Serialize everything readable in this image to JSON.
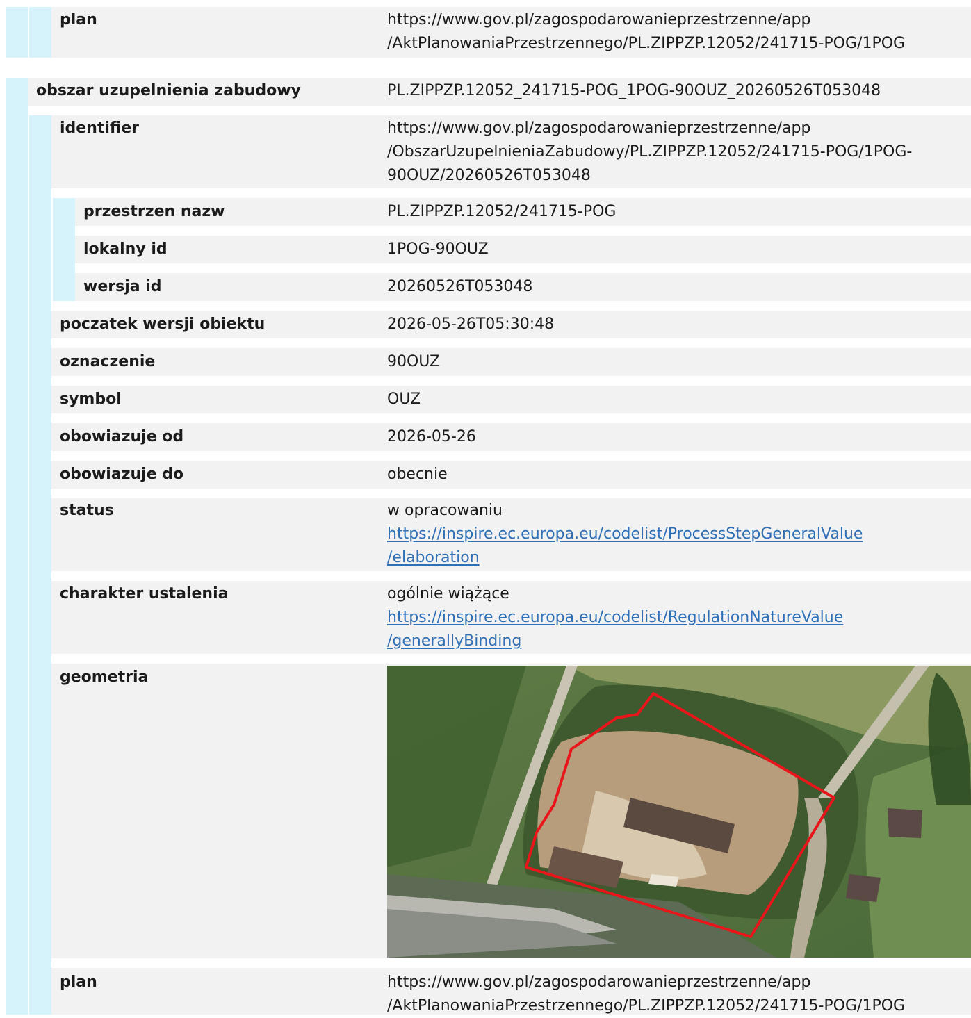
{
  "top_group": {
    "plan_key": "plan",
    "plan_value": [
      "https://www.gov.pl/zagospodarowanieprzestrzenne/app",
      "/AktPlanowaniaPrzestrzennego/PL.ZIPPZP.12052/241715-POG/1POG"
    ]
  },
  "feature": {
    "title_key": "obszar uzupelnienia zabudowy",
    "title_value": "PL.ZIPPZP.12052_241715-POG_1POG-90OUZ_20260526T053048",
    "identifier": {
      "key": "identifier",
      "value": [
        "https://www.gov.pl/zagospodarowanieprzestrzenne/app",
        "/ObszarUzupelnieniaZabudowy/PL.ZIPPZP.12052/241715-POG/1POG-",
        "90OUZ/20260526T053048"
      ],
      "przestrzen_nazw": {
        "key": "przestrzen nazw",
        "value": "PL.ZIPPZP.12052/241715-POG"
      },
      "lokalny_id": {
        "key": "lokalny id",
        "value": "1POG-90OUZ"
      },
      "wersja_id": {
        "key": "wersja id",
        "value": "20260526T053048"
      }
    },
    "poczatek_wersji": {
      "key": "poczatek wersji obiektu",
      "value": "2026-05-26T05:30:48"
    },
    "oznaczenie": {
      "key": "oznaczenie",
      "value": "90OUZ"
    },
    "symbol": {
      "key": "symbol",
      "value": "OUZ"
    },
    "obowiazuje_od": {
      "key": "obowiazuje od",
      "value": "2026-05-26"
    },
    "obowiazuje_do": {
      "key": "obowiazuje do",
      "value": "obecnie"
    },
    "status": {
      "key": "status",
      "label": "w opracowaniu",
      "link": [
        "https://inspire.ec.europa.eu/codelist/ProcessStepGeneralValue",
        "/elaboration"
      ]
    },
    "charakter": {
      "key": "charakter ustalenia",
      "label": "ogólnie wiążące",
      "link": [
        "https://inspire.ec.europa.eu/codelist/RegulationNatureValue",
        "/generallyBinding"
      ]
    },
    "geometria": {
      "key": "geometria",
      "outline_color": "#e8151b"
    },
    "plan": {
      "key": "plan",
      "value": [
        "https://www.gov.pl/zagospodarowanieprzestrzenne/app",
        "/AktPlanowaniaPrzestrzennego/PL.ZIPPZP.12052/241715-POG/1POG"
      ]
    }
  }
}
